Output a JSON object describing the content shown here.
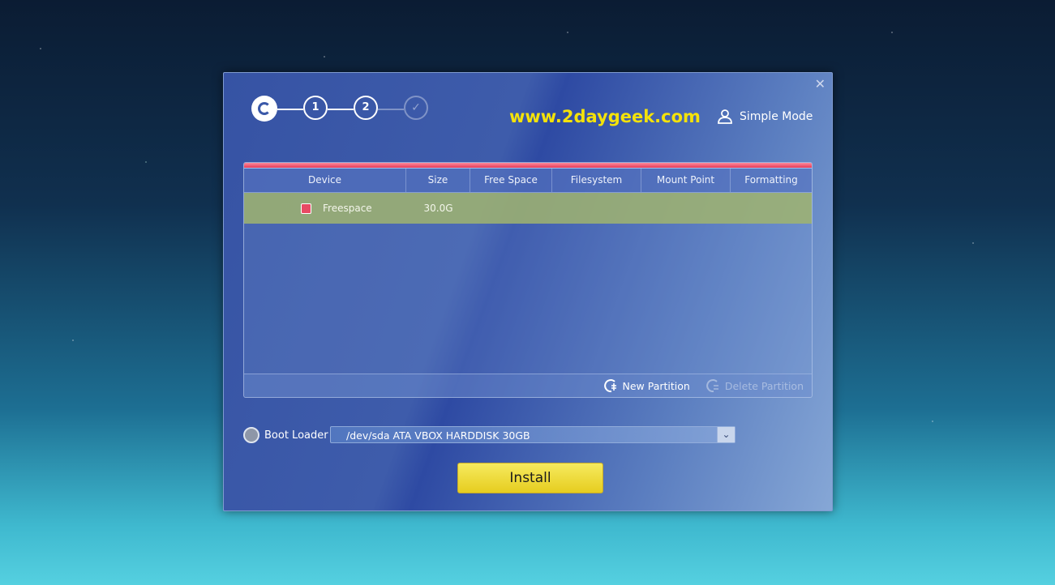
{
  "window": {
    "close_icon": "close-icon"
  },
  "steps": {
    "step1": "1",
    "step2": "2",
    "done_icon": "check-icon"
  },
  "brand": "www.2daygeek.com",
  "mode": {
    "label": "Simple Mode",
    "icon": "person-icon"
  },
  "table": {
    "headers": [
      "Device",
      "Size",
      "Free Space",
      "Filesystem",
      "Mount Point",
      "Formatting"
    ],
    "rows": [
      {
        "device": "Freespace",
        "size": "30.0G",
        "free_space": "",
        "filesystem": "",
        "mount_point": "",
        "formatting": "",
        "color": "#e84a64"
      }
    ],
    "new_partition": "New Partition",
    "delete_partition": "Delete Partition"
  },
  "boot_loader": {
    "label": "Boot Loader",
    "selected": "/dev/sda ATA VBOX HARDDISK 30GB"
  },
  "install_label": "Install",
  "colors": {
    "brand": "#f4e20a",
    "freespace": "#e84a64",
    "install": "#f0dc3c"
  }
}
